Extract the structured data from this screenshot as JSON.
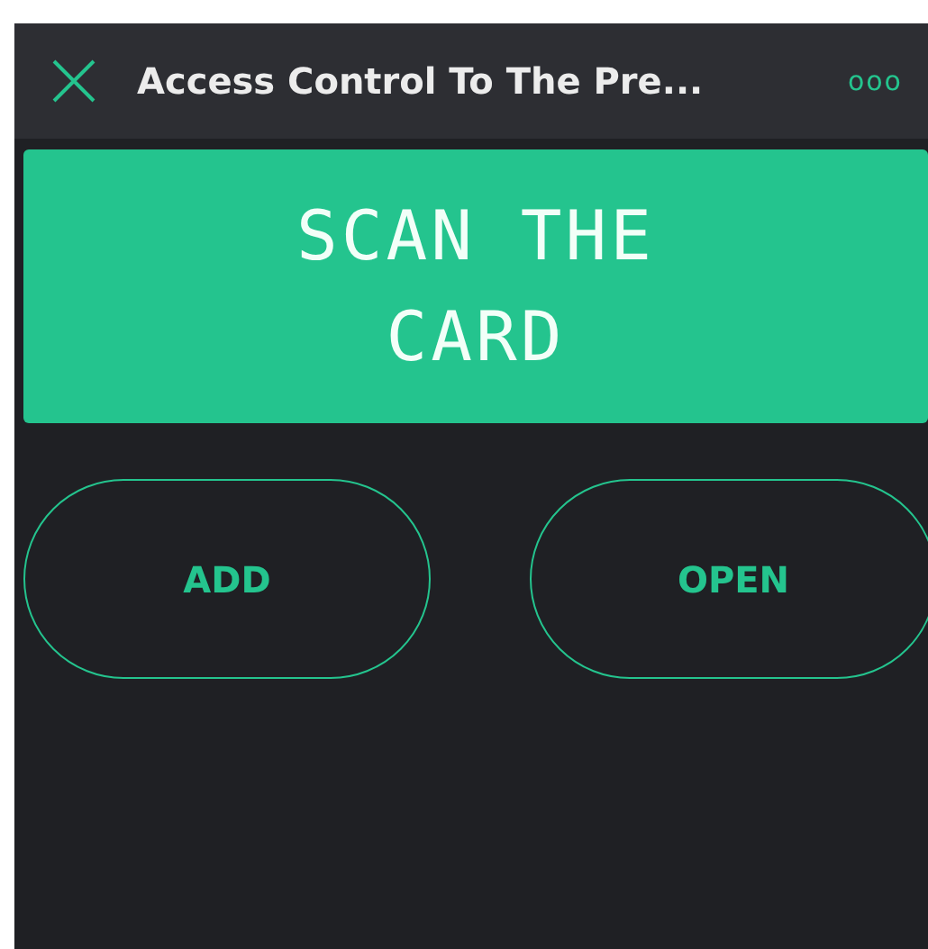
{
  "header": {
    "title": "Access Control To The Pre...",
    "menu": "ooo"
  },
  "lcd": {
    "lines": [
      "SCAN THE",
      "CARD"
    ]
  },
  "buttons": [
    {
      "label": "ADD"
    },
    {
      "label": "OPEN"
    }
  ]
}
